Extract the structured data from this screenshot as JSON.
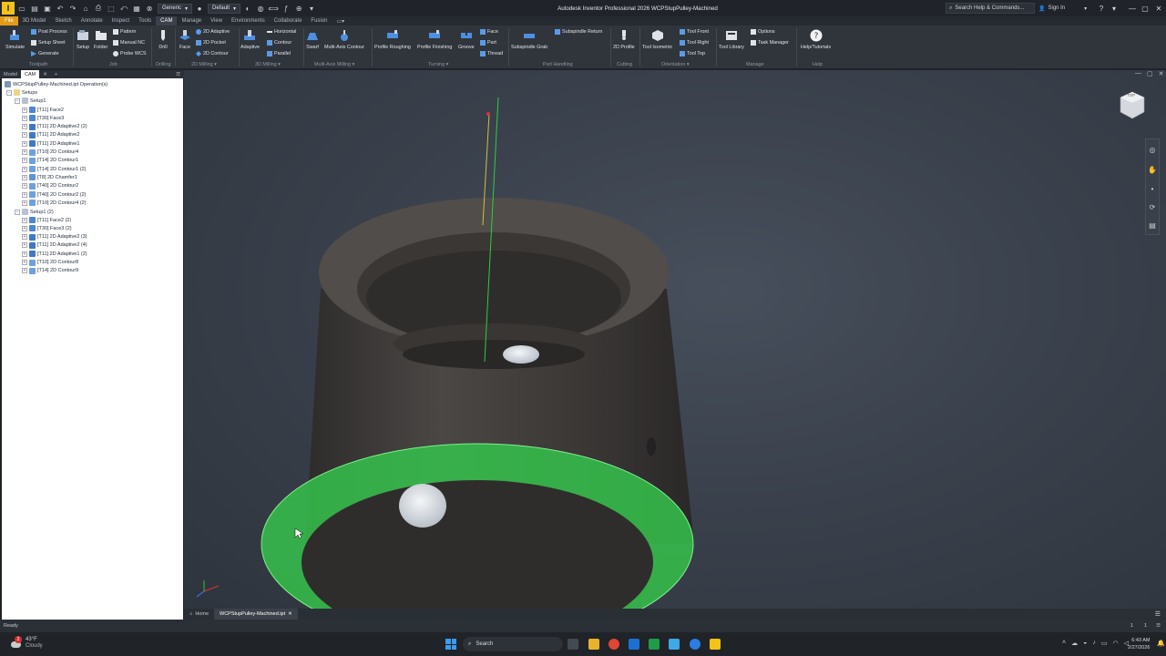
{
  "titlebar": {
    "logo": "I",
    "material": "Generic",
    "appearance": "Default",
    "title": "Autodesk Inventor Professional 2026   WCPStupPulley-Machined",
    "search_placeholder": "Search Help & Commands...",
    "sign_in": "Sign In"
  },
  "ribbon_tabs": [
    "File",
    "3D Model",
    "Sketch",
    "Annotate",
    "Inspect",
    "Tools",
    "CAM",
    "Manage",
    "View",
    "Environments",
    "Collaborate",
    "Fusion"
  ],
  "ribbon": {
    "simulate": "Simulate",
    "post_process": "Post Process",
    "setup_sheet": "Setup Sheet",
    "generate": "Generate",
    "toolpath_group": "Toolpath",
    "setup": "Setup",
    "folder": "Folder",
    "pattern": "Pattern",
    "manual_nc": "Manual NC",
    "probe_wcs": "Probe WCS",
    "job_group": "Job",
    "drill": "Drill",
    "drilling_group": "Drilling",
    "face": "Face",
    "adaptive_2d": "2D Adaptive",
    "pocket_2d": "2D Pocket",
    "contour_2d": "2D Contour",
    "milling2d_group": "2D Milling",
    "adaptive": "Adaptive",
    "horizontal": "Horizontal",
    "contour": "Contour",
    "parallel": "Parallel",
    "milling3d_group": "3D Milling",
    "swarf": "Swarf",
    "multi_axis_contour": "Multi-Axis Contour",
    "multiaxis_group": "Multi-Axis Milling",
    "profile_roughing": "Profile Roughing",
    "profile_finishing": "Profile Finishing",
    "groove": "Groove",
    "t_face": "Face",
    "t_part": "Part",
    "thread": "Thread",
    "turning_group": "Turning",
    "subspindle_grab": "Subspindle Grab",
    "subspindle_return": "Subspindle Return",
    "part_handling_group": "Part Handling",
    "profile_2d": "2D Profile",
    "cutting_group": "Cutting",
    "tool_isometric": "Tool Isometric",
    "tool_front": "Tool Front",
    "tool_right": "Tool Right",
    "tool_top": "Tool Top",
    "orientation_group": "Orientation",
    "tool_library": "Tool Library",
    "options": "Options",
    "task_manager": "Task Manager",
    "manage_group": "Manage",
    "help_tutorials": "Help/Tutorials",
    "help_group": "Help"
  },
  "panel_tabs": [
    "Model",
    "CAM",
    "+"
  ],
  "tree": {
    "root": "WCPStupPulley-Machined.ipt Operation(s)",
    "setups": "Setups",
    "setup1": {
      "label": "Setup1",
      "ops": [
        "[T11] Face2",
        "[T30] Face3",
        "[T11] 2D Adaptive2 (2)",
        "[T11] 2D Adaptive2",
        "[T11] 2D Adaptive1",
        "[T10] 2D Contour4",
        "[T14] 2D Contour1",
        "[T14] 2D Contour1 (2)",
        "[T8] 2D Chamfer1",
        "[T40] 2D Contour2",
        "[T40] 2D Contour2 (2)",
        "[T10] 2D Contour4 (2)"
      ]
    },
    "setup2": {
      "label": "Setup1 (2)",
      "ops": [
        "[T11] Face2 (2)",
        "[T30] Face3 (2)",
        "[T11] 2D Adaptive2 (3)",
        "[T11] 2D Adaptive2 (4)",
        "[T11] 2D Adaptive1 (2)",
        "[T10] 2D Contour8",
        "[T14] 2D Contour9"
      ]
    }
  },
  "viewcube": {
    "label": "TOP"
  },
  "doc_tabs": {
    "home": "Home",
    "file": "WCPStupPulley-Machined.ipt"
  },
  "status": {
    "text": "Ready",
    "num1": "1",
    "num2": "1"
  },
  "taskbar": {
    "weather_temp": "43°F",
    "weather_desc": "Cloudy",
    "weather_badge": "2",
    "search": "Search",
    "time": "6:43 AM",
    "date": "2/27/2026"
  },
  "colors": {
    "accent_file": "#e39b17",
    "selection_green": "#35c24b",
    "viewport_bg": "#3a414c"
  }
}
